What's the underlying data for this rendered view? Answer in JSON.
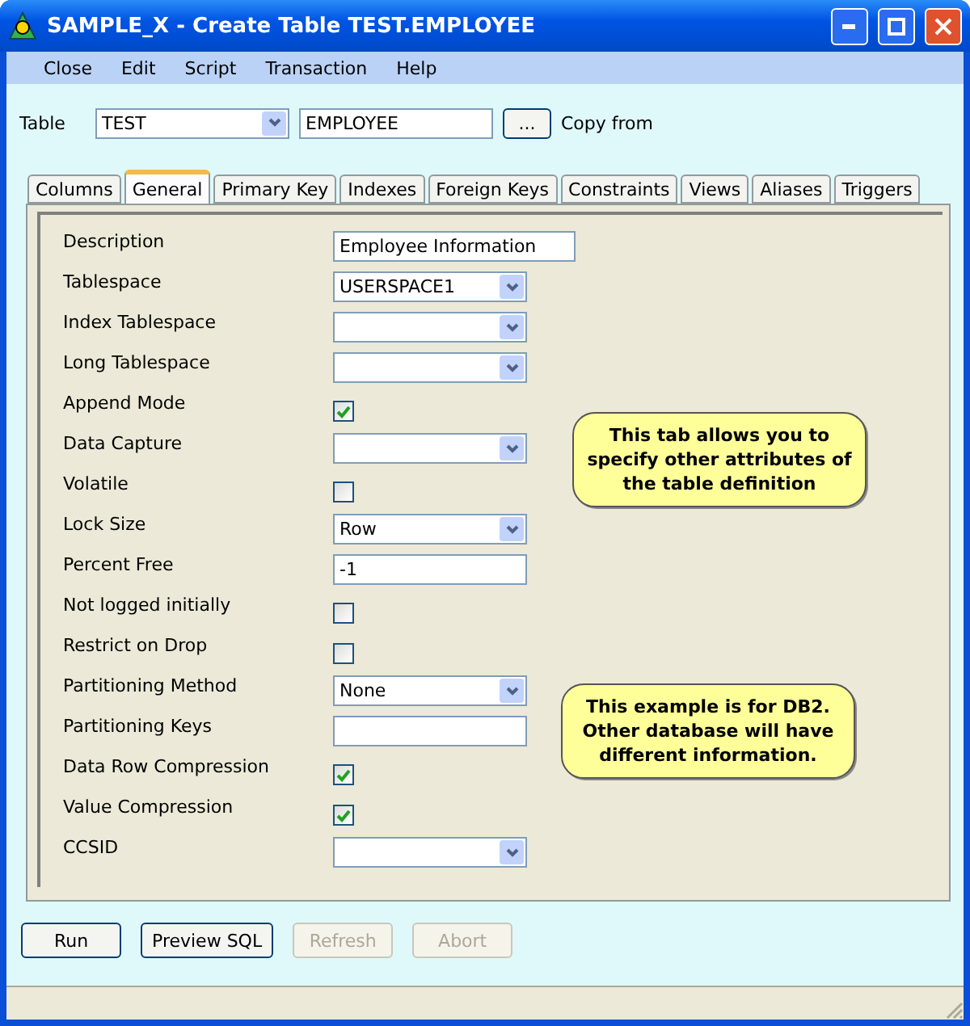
{
  "window": {
    "title": "SAMPLE_X - Create Table TEST.EMPLOYEE"
  },
  "menu": [
    "Close",
    "Edit",
    "Script",
    "Transaction",
    "Help"
  ],
  "table_row": {
    "label": "Table",
    "schema": "TEST",
    "name": "EMPLOYEE",
    "browse": "...",
    "copy_from": "Copy from"
  },
  "tabs": [
    {
      "label": "Columns",
      "selected": false
    },
    {
      "label": "General",
      "selected": true
    },
    {
      "label": "Primary Key",
      "selected": false
    },
    {
      "label": "Indexes",
      "selected": false
    },
    {
      "label": "Foreign Keys",
      "selected": false
    },
    {
      "label": "Constraints",
      "selected": false
    },
    {
      "label": "Views",
      "selected": false
    },
    {
      "label": "Aliases",
      "selected": false
    },
    {
      "label": "Triggers",
      "selected": false
    }
  ],
  "fields": [
    {
      "label": "Description",
      "kind": "text",
      "value": "Employee Information",
      "wide": true
    },
    {
      "label": "Tablespace",
      "kind": "combo",
      "value": "USERSPACE1"
    },
    {
      "label": "Index Tablespace",
      "kind": "combo"
    },
    {
      "label": "Long Tablespace",
      "kind": "combo"
    },
    {
      "label": "Append Mode",
      "kind": "check",
      "checked": true
    },
    {
      "label": "Data Capture",
      "kind": "combo"
    },
    {
      "label": "Volatile",
      "kind": "check",
      "checked": false
    },
    {
      "label": "Lock Size",
      "kind": "combo",
      "value": "Row"
    },
    {
      "label": "Percent Free",
      "kind": "text",
      "value": "-1"
    },
    {
      "label": "Not logged initially",
      "kind": "check",
      "checked": false
    },
    {
      "label": "Restrict on Drop",
      "kind": "check",
      "checked": false
    },
    {
      "label": "Partitioning Method",
      "kind": "combo",
      "value": "None"
    },
    {
      "label": "Partitioning Keys",
      "kind": "text"
    },
    {
      "label": "Data Row Compression",
      "kind": "check",
      "checked": true
    },
    {
      "label": "Value Compression",
      "kind": "check",
      "checked": true
    },
    {
      "label": "CCSID",
      "kind": "combo"
    }
  ],
  "notes": [
    "This tab allows you to specify other attributes of the table definition",
    "This example is for DB2. Other database will have different information."
  ],
  "buttons": [
    {
      "label": "Run",
      "disabled": false
    },
    {
      "label": "Preview SQL",
      "disabled": false
    },
    {
      "label": "Refresh",
      "disabled": true
    },
    {
      "label": "Abort",
      "disabled": true
    }
  ]
}
